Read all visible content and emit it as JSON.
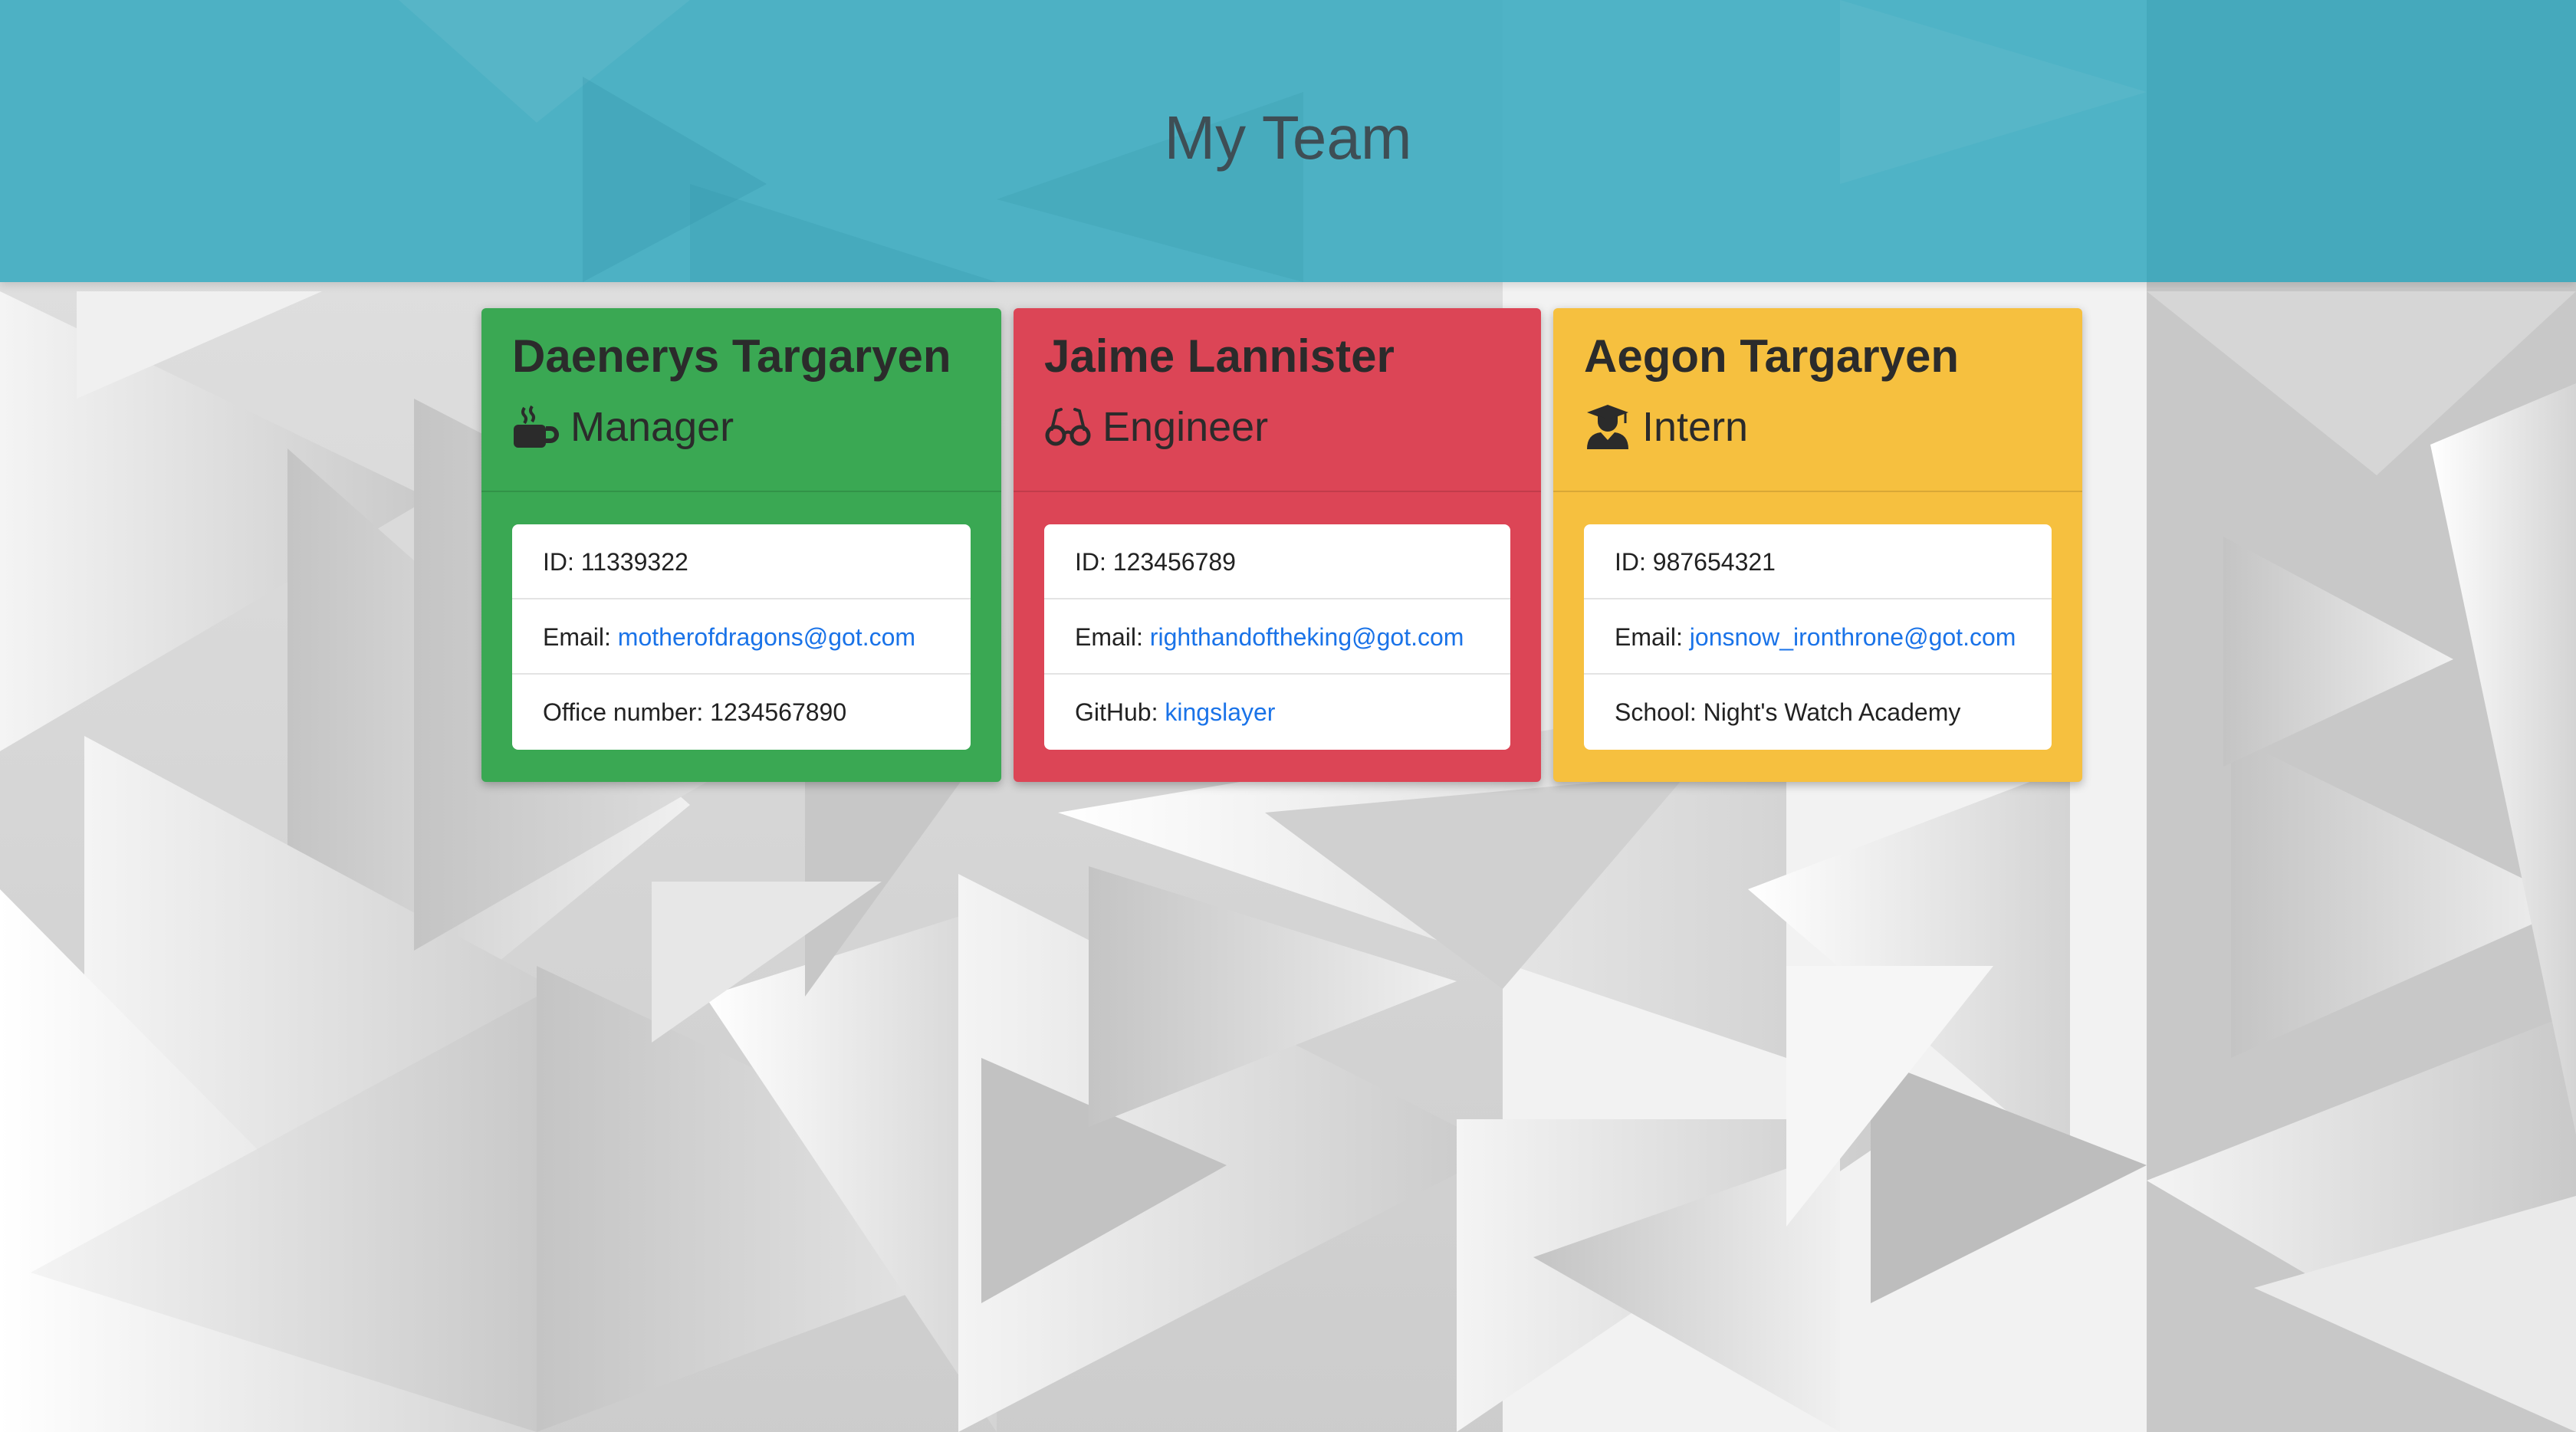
{
  "header": {
    "title": "My Team"
  },
  "colors": {
    "header_bg": "#4fb4c6",
    "manager": "#3aa853",
    "engineer": "#dc4556",
    "intern": "#f6c03f",
    "link": "#1a73e8"
  },
  "cards": [
    {
      "name": "Daenerys Targaryen",
      "role": "Manager",
      "role_icon": "coffee-mug-icon",
      "id_label": "ID:",
      "id_value": "11339322",
      "email_label": "Email:",
      "email_value": "motherofdragons@got.com",
      "extra_label": "Office number:",
      "extra_value": "1234567890"
    },
    {
      "name": "Jaime Lannister",
      "role": "Engineer",
      "role_icon": "glasses-icon",
      "id_label": "ID:",
      "id_value": "123456789",
      "email_label": "Email:",
      "email_value": "righthandoftheking@got.com",
      "extra_label": "GitHub:",
      "extra_value": "kingslayer"
    },
    {
      "name": "Aegon Targaryen",
      "role": "Intern",
      "role_icon": "graduate-icon",
      "id_label": "ID:",
      "id_value": "987654321",
      "email_label": "Email:",
      "email_value": "jonsnow_ironthrone@got.com",
      "extra_label": "School:",
      "extra_value": "Night's Watch Academy"
    }
  ]
}
